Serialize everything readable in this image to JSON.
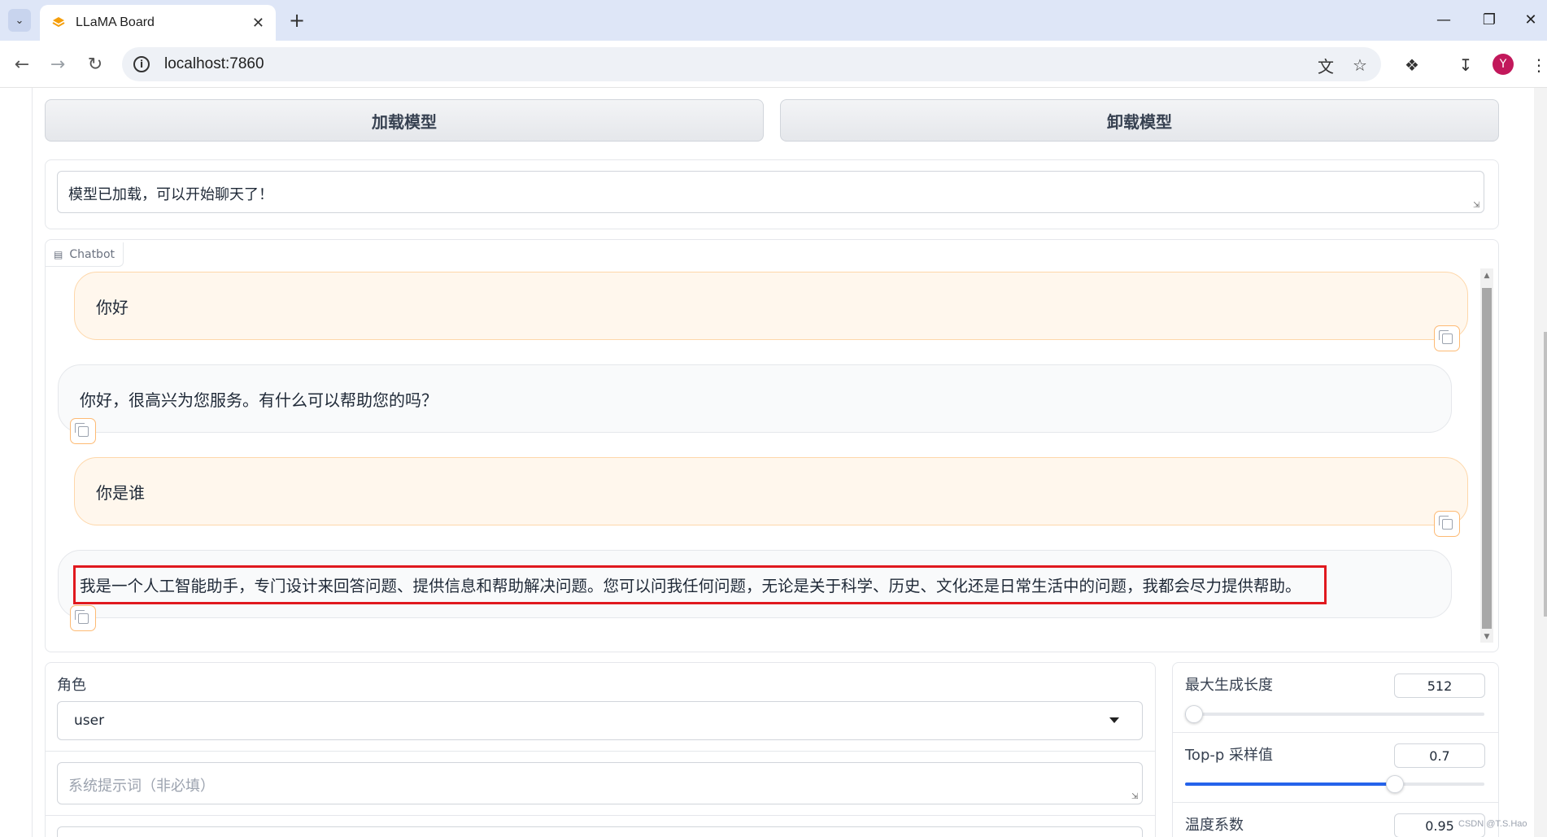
{
  "browser": {
    "tab_title": "LLaMA Board",
    "url": "localhost:7860",
    "avatar_letter": "Y",
    "icons": [
      "tab-list-icon",
      "tab-favicon",
      "close-icon",
      "plus-icon",
      "minimize-icon",
      "maximize-icon",
      "window-close-icon",
      "back-icon",
      "forward-icon",
      "reload-icon",
      "info-icon",
      "translate-icon",
      "star-icon",
      "extensions-icon",
      "download-icon",
      "menu-icon"
    ]
  },
  "controls": {
    "load_model_label": "加载模型",
    "unload_model_label": "卸载模型",
    "status_text": "模型已加载，可以开始聊天了！"
  },
  "chatbot": {
    "label": "Chatbot",
    "messages": [
      {
        "role": "user",
        "text": "你好"
      },
      {
        "role": "assistant",
        "text": "你好，很高兴为您服务。有什么可以帮助您的吗？"
      },
      {
        "role": "user",
        "text": "你是谁"
      },
      {
        "role": "assistant",
        "text": "我是一个人工智能助手，专门设计来回答问题、提供信息和帮助解决问题。您可以问我任何问题，无论是关于科学、历史、文化还是日常生活中的问题，我都会尽力提供帮助。"
      }
    ],
    "highlight_color": "#e0191f"
  },
  "form": {
    "role_label": "角色",
    "role_value": "user",
    "system_prompt_placeholder": "系统提示词（非必填）"
  },
  "params": {
    "max_length": {
      "label": "最大生成长度",
      "value": "512",
      "fraction": 0.03
    },
    "top_p": {
      "label": "Top-p 采样值",
      "value": "0.7",
      "fraction": 0.7
    },
    "temperature": {
      "label": "温度系数",
      "value": "0.95"
    }
  },
  "watermark": "CSDN @T.S.Hao",
  "colors": {
    "accent": "#2563eb",
    "user_bubble": "#fff7ed",
    "bot_bubble": "#f9fafb",
    "tabbar": "#dee6f7"
  }
}
